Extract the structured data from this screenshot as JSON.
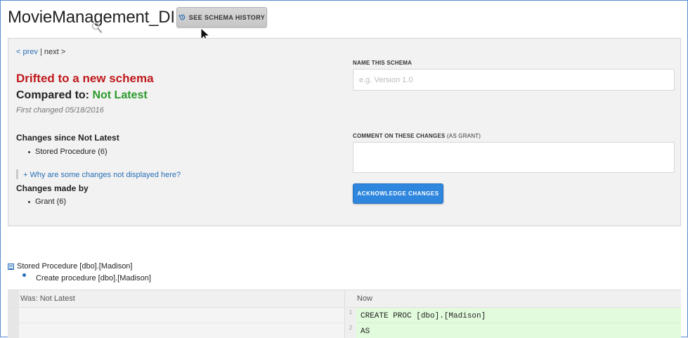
{
  "header": {
    "title": "MovieManagement_DI",
    "history_button": "SEE SCHEMA HISTORY"
  },
  "pager": {
    "prev": "< prev",
    "separator": "|",
    "next": "next >"
  },
  "status": {
    "drift": "Drifted to a new schema",
    "compared_label": "Compared to:",
    "compared_value": "Not Latest",
    "first_changed": "First changed 05/18/2016"
  },
  "changes_since": {
    "title": "Changes since Not Latest",
    "items": [
      "Stored Procedure (6)"
    ]
  },
  "why_link": "+ Why are some changes not displayed here?",
  "changes_by": {
    "title": "Changes made by",
    "items": [
      "Grant (6)"
    ]
  },
  "form": {
    "name_label": "NAME THIS SCHEMA",
    "name_placeholder": "e.g. Version 1.0",
    "comment_label": "COMMENT ON THESE CHANGES",
    "comment_label_suffix": "(AS GRANT)",
    "ack_button": "ACKNOWLEDGE CHANGES"
  },
  "object": {
    "name": "Stored Procedure [dbo].[Madison]",
    "action": "Create procedure [dbo].[Madison]"
  },
  "diff": {
    "was_header": "Was: Not Latest",
    "now_header": "Now",
    "lines": [
      {
        "num": "1",
        "text": "CREATE PROC [dbo].[Madison]"
      },
      {
        "num": "2",
        "text": "AS"
      }
    ]
  },
  "colors": {
    "drift": "#c0191c",
    "not_latest": "#2b9a2b",
    "accent": "#2e86de",
    "added_line": "#e2fbdc"
  }
}
